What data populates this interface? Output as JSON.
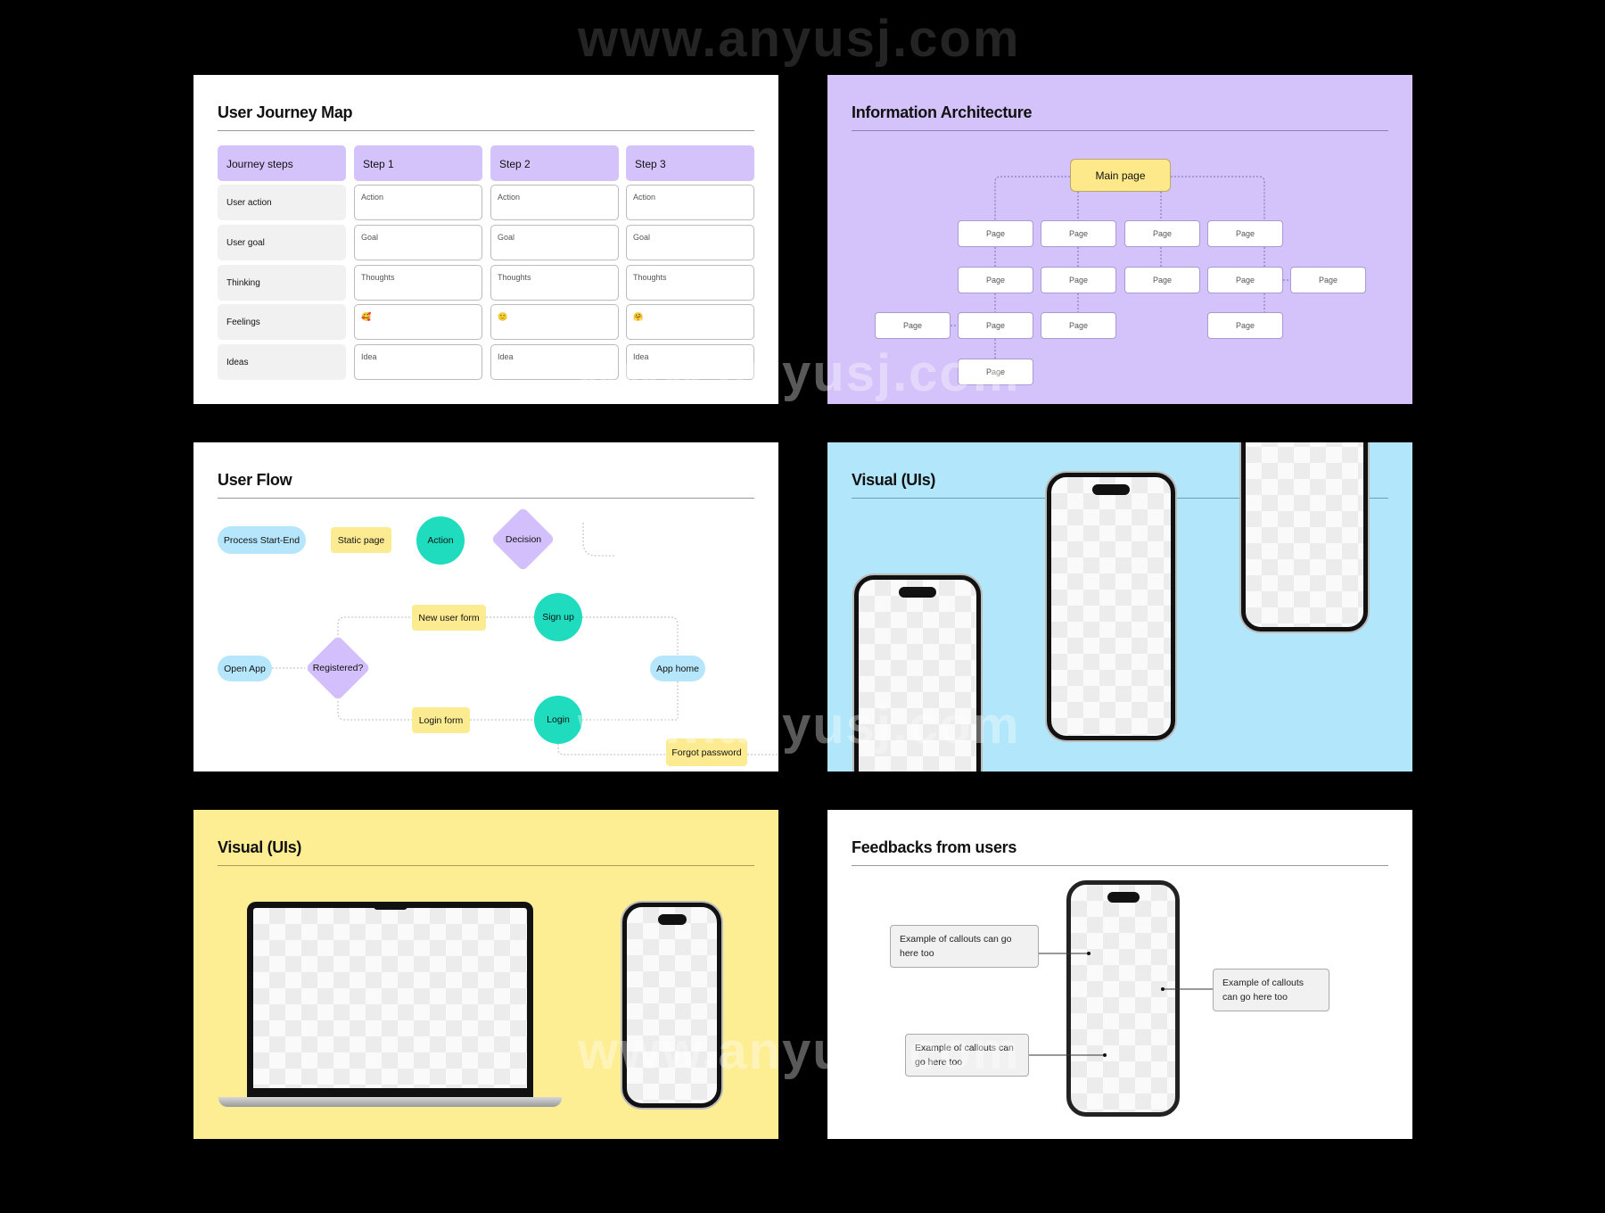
{
  "watermark": "www.anyusj.com",
  "colors": {
    "lavender": "#d4c2fb",
    "yellow": "#fdeb91",
    "sky": "#b5e6fb",
    "teal": "#1fdcbe",
    "background": "#000000"
  },
  "journey": {
    "title": "User Journey Map",
    "header": [
      "Journey steps",
      "Step 1",
      "Step 2",
      "Step 3"
    ],
    "rows": [
      {
        "label": "User action",
        "values": [
          "Action",
          "Action",
          "Action"
        ]
      },
      {
        "label": "User goal",
        "values": [
          "Goal",
          "Goal",
          "Goal"
        ]
      },
      {
        "label": "Thinking",
        "values": [
          "Thoughts",
          "Thoughts",
          "Thoughts"
        ]
      },
      {
        "label": "Feelings",
        "values": [
          "🥰",
          "🙂",
          "🤗"
        ]
      },
      {
        "label": "Ideas",
        "values": [
          "Idea",
          "Idea",
          "Idea"
        ]
      }
    ]
  },
  "ia": {
    "title": "Information Architecture",
    "main": "Main page",
    "pages": [
      "Page",
      "Page",
      "Page",
      "Page",
      "Page",
      "Page",
      "Page",
      "Page",
      "Page",
      "Page",
      "Page",
      "Page",
      "Page",
      "Page"
    ]
  },
  "flow": {
    "title": "User Flow",
    "legend": {
      "process": "Process Start-End",
      "static": "Static page",
      "action": "Action",
      "decision": "Decision"
    },
    "nodes": {
      "open": "Open App",
      "registered": "Registered?",
      "new_user": "New user form",
      "signup": "Sign up",
      "app_home": "App home",
      "login_form": "Login form",
      "login": "Login",
      "forgot": "Forgot password"
    }
  },
  "visual_blue": {
    "title": "Visual (UIs)"
  },
  "visual_yellow": {
    "title": "Visual (UIs)"
  },
  "feedback": {
    "title": "Feedbacks from users",
    "callouts": [
      "Example of callouts can go here too",
      "Example of callouts can go here too",
      "Example of callouts can go here too"
    ]
  }
}
